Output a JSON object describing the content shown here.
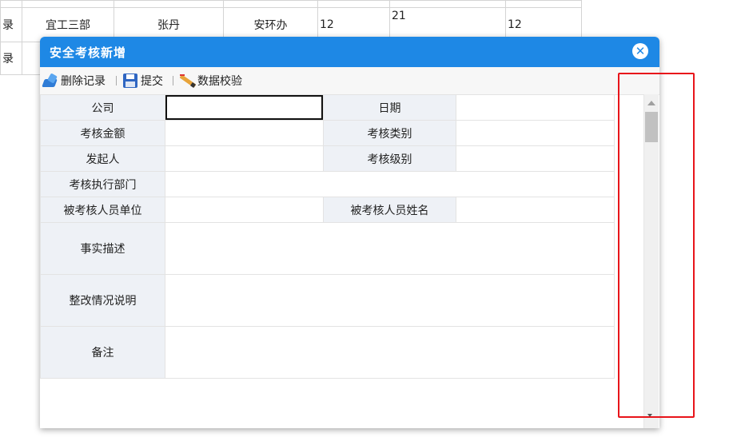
{
  "background_table": {
    "row1": [
      "宜工三部",
      "张丹",
      "安环办",
      "12",
      "21",
      "12"
    ]
  },
  "dialog": {
    "title": "安全考核新增",
    "close_icon": "close-circle-icon",
    "toolbar": {
      "delete_label": "删除记录",
      "submit_label": "提交",
      "validate_label": "数据校验"
    },
    "form": {
      "company": "公司",
      "date": "日期",
      "amount": "考核金额",
      "type": "考核类别",
      "initiator": "发起人",
      "level": "考核级别",
      "exec_dept": "考核执行部门",
      "assessed_unit": "被考核人员单位",
      "assessed_name": "被考核人员姓名",
      "fact_desc": "事实描述",
      "rectify_desc": "整改情况说明",
      "remark": "备注"
    },
    "colors": {
      "titlebar": "#1e88e5",
      "label_bg": "#eef1f6",
      "highlight": "#e8141a"
    }
  }
}
